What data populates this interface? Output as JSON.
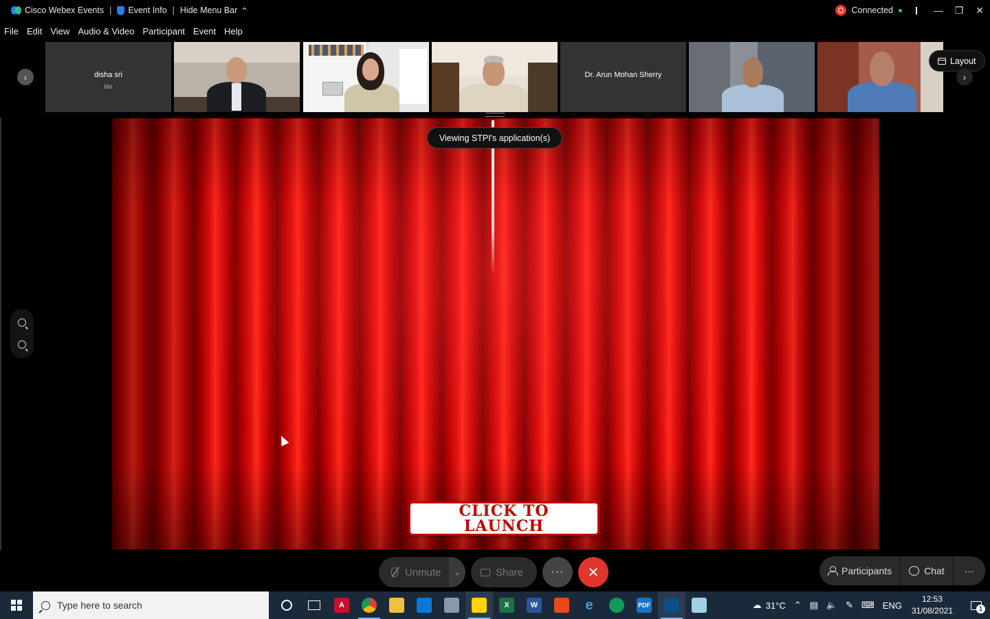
{
  "titlebar": {
    "app_name": "Cisco Webex Events",
    "event_info": "Event Info",
    "hide_menu": "Hide Menu Bar",
    "status": "Connected",
    "colors": {
      "record": "#e0362e",
      "connected_dot": "#2ecc71"
    }
  },
  "menu": {
    "file": "File",
    "edit": "Edit",
    "view": "View",
    "audio_video": "Audio & Video",
    "participant": "Participant",
    "event": "Event",
    "help": "Help"
  },
  "filmstrip": {
    "tiles": [
      {
        "name": "disha sri",
        "sub": "Me",
        "type": "placeholder"
      },
      {
        "name": "",
        "type": "video"
      },
      {
        "name": "",
        "type": "video"
      },
      {
        "name": "",
        "type": "video"
      },
      {
        "name": "Dr. Arun Mohan Sherry",
        "type": "placeholder"
      },
      {
        "name": "",
        "type": "video"
      },
      {
        "name": "",
        "type": "video"
      }
    ],
    "layout_label": "Layout"
  },
  "stage": {
    "viewing_label": "Viewing STPI's application(s)",
    "launch_line1": "CLICK TO",
    "launch_line2": "LAUNCH"
  },
  "controls": {
    "unmute": "Unmute",
    "share": "Share",
    "more": "···",
    "end": "✕",
    "participants": "Participants",
    "chat": "Chat",
    "overflow": "···",
    "colors": {
      "end_call": "#e0362e"
    }
  },
  "taskbar": {
    "search_placeholder": "Type here to search",
    "weather": "31°C",
    "language": "ENG",
    "time": "12:53",
    "date": "31/08/2021",
    "notification_count": "1"
  }
}
